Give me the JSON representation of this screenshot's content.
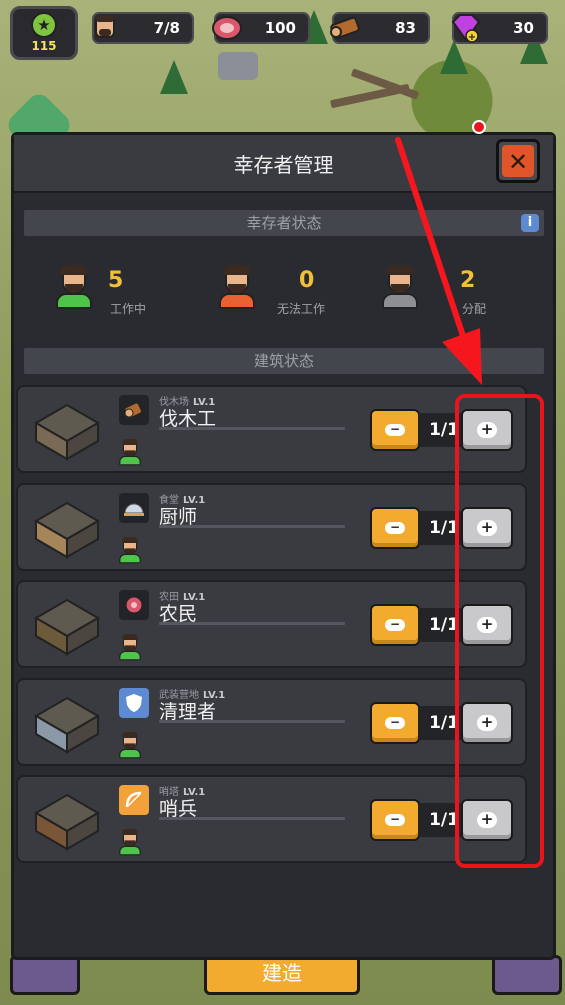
{
  "resources": {
    "level": "115",
    "survivors": "7/8",
    "meat": "100",
    "wood": "83",
    "gems": "30"
  },
  "panel": {
    "title": "幸存者管理",
    "close_label": "✕"
  },
  "survivor_status": {
    "header": "幸存者状态",
    "info_label": "i",
    "stats": [
      {
        "value": "5",
        "label": "工作中",
        "color": "#4fc44a"
      },
      {
        "value": "0",
        "label": "无法工作",
        "color": "#e8612e"
      },
      {
        "value": "2",
        "label": "分配",
        "color": "#8d8f94"
      }
    ]
  },
  "building_status": {
    "header": "建筑状态",
    "rows": [
      {
        "building": "伐木场",
        "level": "LV.1",
        "job": "伐木工",
        "count": "1/1",
        "icon": "wood-log-icon"
      },
      {
        "building": "食堂",
        "level": "LV.1",
        "job": "厨师",
        "count": "1/1",
        "icon": "food-tray-icon"
      },
      {
        "building": "农田",
        "level": "LV.1",
        "job": "农民",
        "count": "1/1",
        "icon": "meat-icon"
      },
      {
        "building": "武装营地",
        "level": "LV.1",
        "job": "清理者",
        "count": "1/1",
        "icon": "shield-icon"
      },
      {
        "building": "哨塔",
        "level": "LV.1",
        "job": "哨兵",
        "count": "1/1",
        "icon": "bow-icon"
      }
    ],
    "minus_label": "−",
    "plus_label": "+"
  },
  "bottom": {
    "build_label": "建造"
  },
  "colors": {
    "accent_orange": "#f2ab2e",
    "highlight_red": "#e8161c",
    "panel_bg": "#2a2b30"
  }
}
